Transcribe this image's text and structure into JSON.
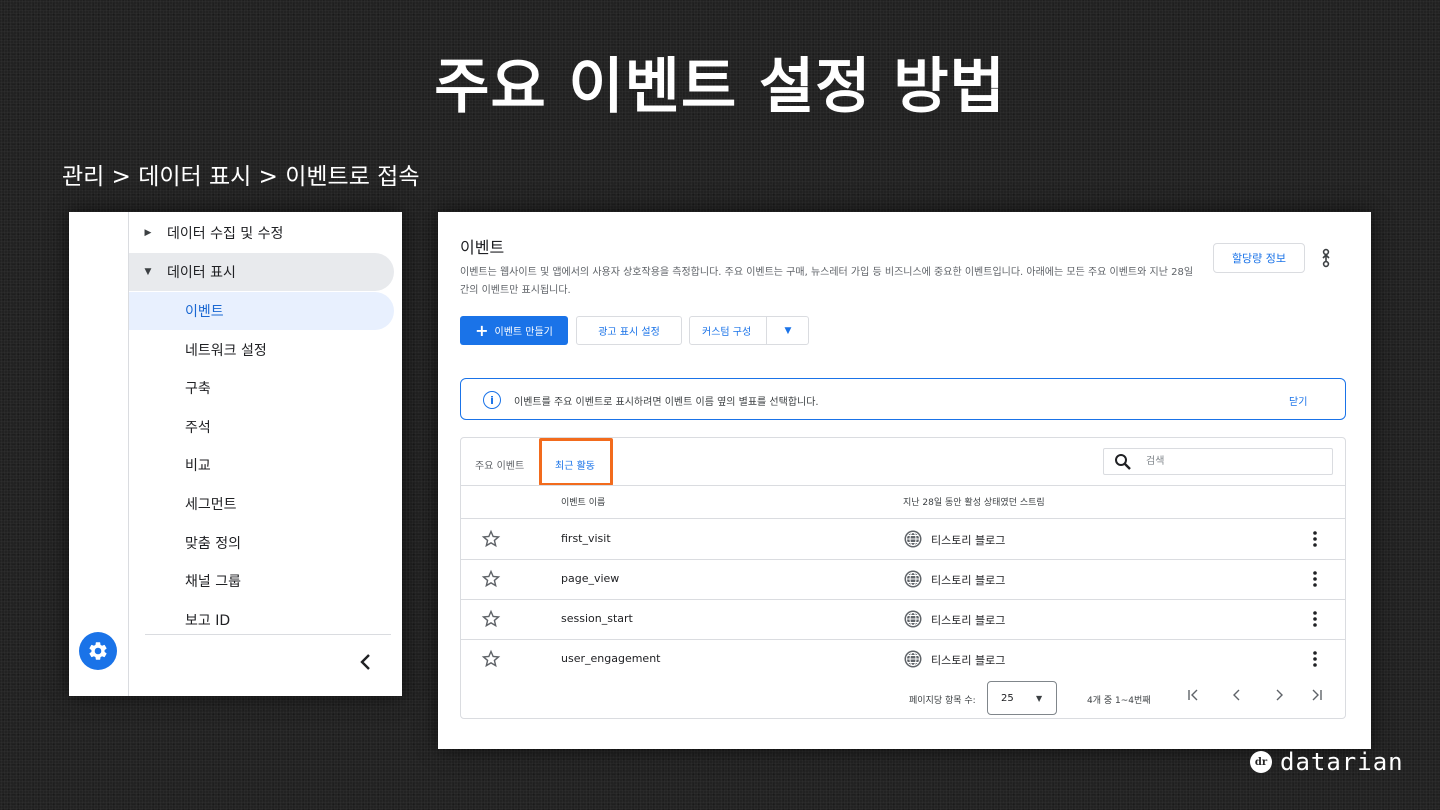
{
  "slide": {
    "title": "주요 이벤트 설정 방법",
    "path": "관리 > 데이터 표시 > 이벤트로 접속"
  },
  "left_nav": {
    "sections": [
      {
        "label": "데이터 수집 및 수정",
        "expanded": false
      },
      {
        "label": "데이터 표시",
        "expanded": true
      }
    ],
    "items": [
      {
        "label": "이벤트",
        "active": true
      },
      {
        "label": "네트워크 설정"
      },
      {
        "label": "구축"
      },
      {
        "label": "주석"
      },
      {
        "label": "비교"
      },
      {
        "label": "세그먼트"
      },
      {
        "label": "맞춤 정의"
      },
      {
        "label": "채널 그룹"
      },
      {
        "label": "보고 ID"
      }
    ]
  },
  "events_page": {
    "title": "이벤트",
    "description": "이벤트는 웹사이트 및 앱에서의 사용자 상호작용을 측정합니다. 주요 이벤트는 구매, 뉴스레터 가입 등 비즈니스에 중요한 이벤트입니다. 아래에는 모든 주요 이벤트와 지난 28일간의 이벤트만 표시됩니다.",
    "quota_button": "할당량 정보",
    "create_button": "이벤트 만들기",
    "ad_button": "광고 표시 설정",
    "custom_button": "커스텀 구성",
    "info_text": "이벤트를 주요 이벤트로 표시하려면 이벤트 이름 옆의 별표를 선택합니다.",
    "info_close": "닫기",
    "tabs": {
      "key_events": "주요 이벤트",
      "recent": "최근 활동"
    },
    "search_placeholder": "검색",
    "columns": {
      "name": "이벤트 이름",
      "streams": "지난 28일 동안 활성 상태였던 스트림"
    },
    "rows": [
      {
        "name": "first_visit",
        "stream": "티스토리 블로그"
      },
      {
        "name": "page_view",
        "stream": "티스토리 블로그"
      },
      {
        "name": "session_start",
        "stream": "티스토리 블로그"
      },
      {
        "name": "user_engagement",
        "stream": "티스토리 블로그"
      }
    ],
    "pager": {
      "label": "페이지당 항목 수:",
      "per_page": "25",
      "range": "4개 중 1~4번째"
    }
  },
  "brand": {
    "logo": "dr",
    "name": "datarian"
  },
  "colors": {
    "accent": "#1a73e8",
    "highlight": "#f26b1d"
  }
}
